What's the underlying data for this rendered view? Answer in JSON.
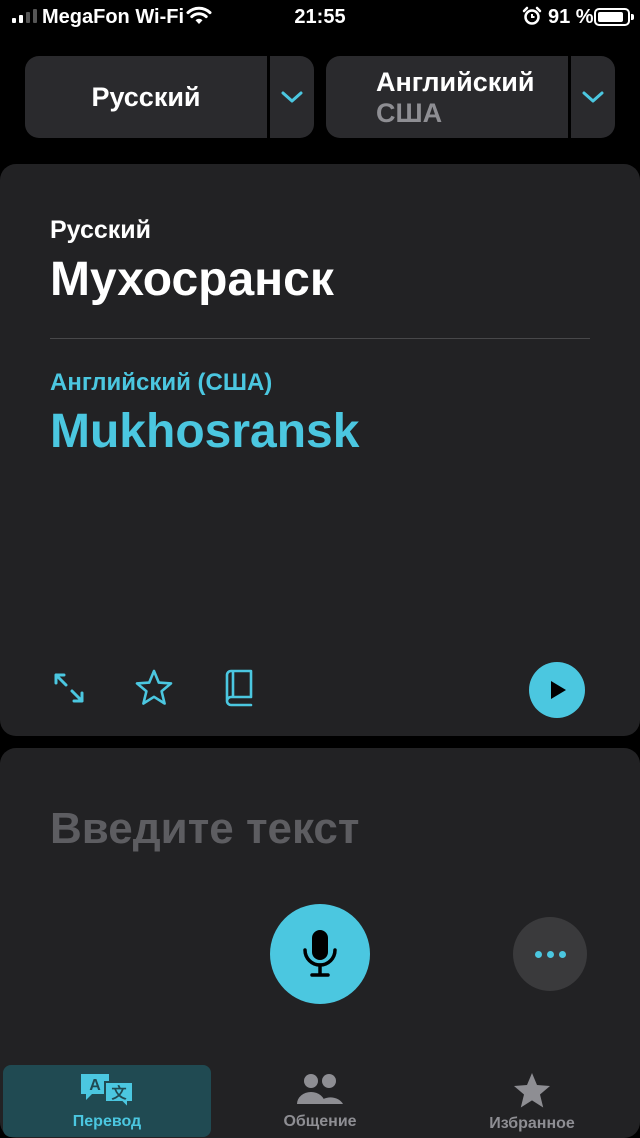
{
  "status_bar": {
    "carrier": "MegaFon Wi-Fi",
    "time": "21:55",
    "battery_text": "91 %",
    "battery_level": 0.91,
    "signal_bars": 4,
    "signal_bars_active": 2
  },
  "language_from": {
    "name": "Русский"
  },
  "language_to": {
    "name": "Английский",
    "region": "США"
  },
  "translation": {
    "source_label": "Русский",
    "source_text": "Мухосранск",
    "target_label": "Английский (США)",
    "target_text": "Mukhosransk"
  },
  "input": {
    "placeholder": "Введите текст"
  },
  "tabs": [
    {
      "label": "Перевод",
      "icon": "translate-icon",
      "active": true
    },
    {
      "label": "Общение",
      "icon": "people-icon",
      "active": false
    },
    {
      "label": "Избранное",
      "icon": "star-icon",
      "active": false
    }
  ],
  "colors": {
    "accent": "#4bc7e0",
    "card": "#222224",
    "background": "#000000",
    "placeholder": "#5d5d61",
    "secondary_text": "#8e8e93"
  }
}
